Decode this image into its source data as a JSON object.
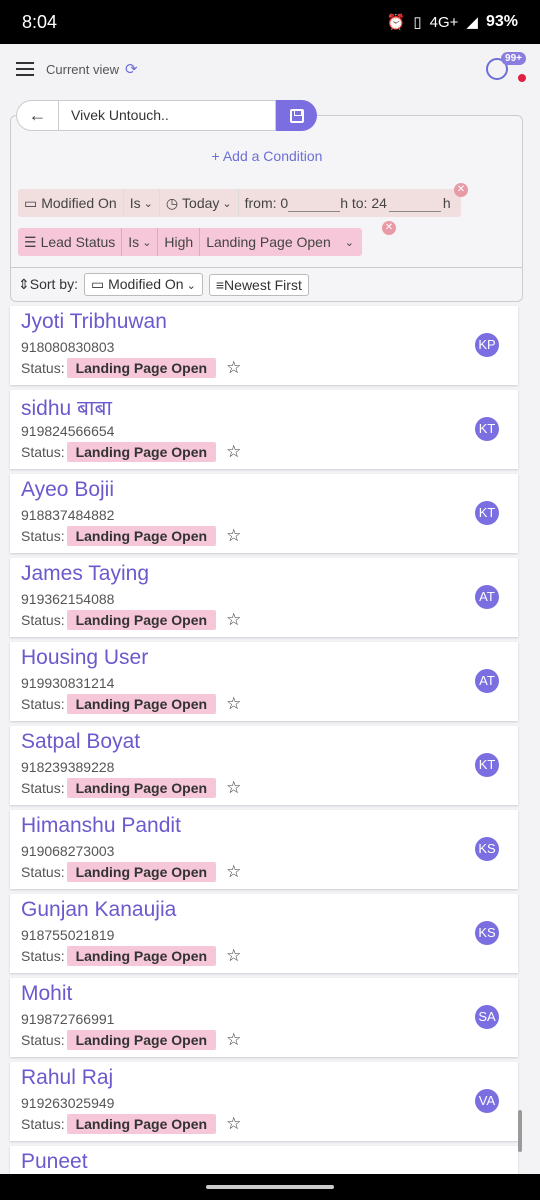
{
  "statusbar": {
    "time": "8:04",
    "network": "4G+",
    "battery": "93%"
  },
  "header": {
    "current_view_label": "Current view",
    "notif_badge": "99+"
  },
  "view": {
    "name": "Vivek Untouch.."
  },
  "add_condition_label": "+ Add a Condition",
  "filter1": {
    "field": "Modified On",
    "op": "Is",
    "value": "Today",
    "from_label": "from: 0",
    "to_label": "h to: 24",
    "h": "h"
  },
  "filter2": {
    "field": "Lead Status",
    "op": "Is",
    "priority": "High",
    "value": "Landing Page Open"
  },
  "sort": {
    "label": "Sort by:",
    "field": "Modified On",
    "order": "Newest First"
  },
  "leads": [
    {
      "name": "Jyoti Tribhuwan",
      "phone": "918080830803",
      "status_label": "Status:",
      "status": "Landing Page Open",
      "avatar": "KP"
    },
    {
      "name": "sidhu बाबा",
      "phone": "919824566654",
      "status_label": "Status:",
      "status": "Landing Page Open",
      "avatar": "KT"
    },
    {
      "name": "Ayeo Bojii",
      "phone": "918837484882",
      "status_label": "Status:",
      "status": "Landing Page Open",
      "avatar": "KT"
    },
    {
      "name": "James Taying",
      "phone": "919362154088",
      "status_label": "Status:",
      "status": "Landing Page Open",
      "avatar": "AT"
    },
    {
      "name": "Housing User",
      "phone": "919930831214",
      "status_label": "Status:",
      "status": "Landing Page Open",
      "avatar": "AT"
    },
    {
      "name": "Satpal Boyat",
      "phone": "918239389228",
      "status_label": "Status:",
      "status": "Landing Page Open",
      "avatar": "KT"
    },
    {
      "name": "Himanshu Pandit",
      "phone": "919068273003",
      "status_label": "Status:",
      "status": "Landing Page Open",
      "avatar": "KS"
    },
    {
      "name": "Gunjan Kanaujia",
      "phone": "918755021819",
      "status_label": "Status:",
      "status": "Landing Page Open",
      "avatar": "KS"
    },
    {
      "name": "Mohit",
      "phone": "919872766991",
      "status_label": "Status:",
      "status": "Landing Page Open",
      "avatar": "SA"
    },
    {
      "name": "Rahul Raj",
      "phone": "919263025949",
      "status_label": "Status:",
      "status": "Landing Page Open",
      "avatar": "VA"
    },
    {
      "name": "Puneet"
    }
  ]
}
